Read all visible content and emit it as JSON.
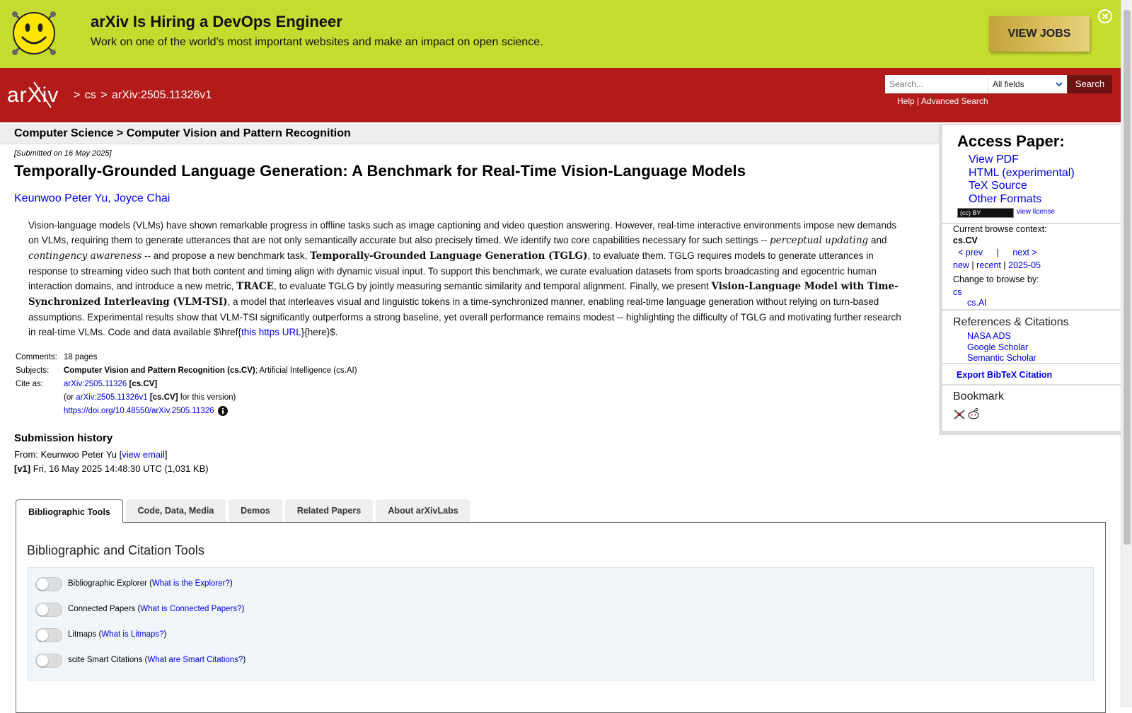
{
  "banner": {
    "title": "arXiv Is Hiring a DevOps Engineer",
    "subtitle": "Work on one of the world's most important websites and make an impact on open science.",
    "cta": "VIEW JOBS"
  },
  "header": {
    "logo_text": "arXiv",
    "breadcrumb": [
      ">",
      "cs",
      ">",
      "arXiv:2505.11326v1"
    ],
    "search_placeholder": "Search...",
    "search_field": "All fields",
    "search_button": "Search",
    "help": "Help",
    "sep": "|",
    "advanced": "Advanced Search"
  },
  "subheader": "Computer Science > Computer Vision and Pattern Recognition",
  "paper": {
    "submitted": "[Submitted on 16 May 2025]",
    "title": "Temporally-Grounded Language Generation: A Benchmark for Real-Time Vision-Language Models",
    "authors": [
      "Keunwoo Peter Yu",
      "Joyce Chai"
    ],
    "author_sep": ", ",
    "abstract": {
      "p1": "Vision-language models (VLMs) have shown remarkable progress in offline tasks such as image captioning and video question answering. However, real-time interactive environments impose new demands on VLMs, requiring them to generate utterances that are not only semantically accurate but also precisely timed. We identify two core capabilities necessary for such settings -- ",
      "m1": "perceptual updating",
      "p2": " and ",
      "m2": "contingency awareness",
      "p3": " -- and propose a new benchmark task, ",
      "m3": "Temporally-Grounded Language Generation (TGLG)",
      "p4": ", to evaluate them. TGLG requires models to generate utterances in response to streaming video such that both content and timing align with dynamic visual input. To support this benchmark, we curate evaluation datasets from sports broadcasting and egocentric human interaction domains, and introduce a new metric, ",
      "m4": "TRACE",
      "p5": ", to evaluate TGLG by jointly measuring semantic similarity and temporal alignment. Finally, we present ",
      "m5": "Vision-Language Model with Time-Synchronized Interleaving (VLM-TSI)",
      "p6": ", a model that interleaves visual and linguistic tokens in a time-synchronized manner, enabling real-time language generation without relying on turn-based assumptions. Experimental results show that VLM-TSI significantly outperforms a strong baseline, yet overall performance remains modest -- highlighting the difficulty of TGLG and motivating further research in real-time VLMs. Code and data available $\\href{",
      "link": "this https URL",
      "p7": "}{here}$."
    },
    "meta": {
      "comments_label": "Comments:",
      "comments": "18 pages",
      "subjects_label": "Subjects:",
      "subjects_primary": "Computer Vision and Pattern Recognition (cs.CV)",
      "subjects_rest": "; Artificial Intelligence (cs.AI)",
      "cite_label": "Cite as:",
      "cite_id": "arXiv:2505.11326",
      "cite_cat": " [cs.CV]",
      "cite_or": "(or ",
      "cite_version": "arXiv:2505.11326v1",
      "cite_version_cat": " [cs.CV]",
      "cite_version_tail": " for this version)",
      "doi": "https://doi.org/10.48550/arXiv.2505.11326"
    },
    "history": {
      "title": "Submission history",
      "from_prefix": "From: Keunwoo Peter Yu [",
      "view_email": "view email",
      "from_suffix": "]",
      "v1_tag": "[v1]",
      "v1_text": " Fri, 16 May 2025 14:48:30 UTC (1,031 KB)"
    }
  },
  "tabs": [
    "Bibliographic Tools",
    "Code, Data, Media",
    "Demos",
    "Related Papers",
    "About arXivLabs"
  ],
  "tools_panel": {
    "title": "Bibliographic and Citation Tools",
    "rows": [
      {
        "label": "Bibliographic Explorer",
        "help": "What is the Explorer?"
      },
      {
        "label": "Connected Papers",
        "help": "What is Connected Papers?"
      },
      {
        "label": "Litmaps",
        "help": "What is Litmaps?"
      },
      {
        "label": "scite Smart Citations",
        "help": "What are Smart Citations?"
      }
    ]
  },
  "sidebar": {
    "access_title": "Access Paper:",
    "access_links": [
      "View PDF",
      "HTML (experimental)",
      "TeX Source",
      "Other Formats"
    ],
    "license_badge": "(cc) BY",
    "view_license": "view license",
    "browse_context_label": "Current browse context:",
    "browse_context": "cs.CV",
    "prev": "< prev",
    "pipe": "|",
    "next": "next >",
    "new": "new",
    "recent": "recent",
    "month": "2025-05",
    "change_browse": "Change to browse by:",
    "cat1": "cs",
    "cat2": "cs.AI",
    "refs_title": "References & Citations",
    "refs": [
      "NASA ADS",
      "Google Scholar",
      "Semantic Scholar"
    ],
    "bibtex": "Export BibTeX Citation",
    "bookmark": "Bookmark"
  },
  "colors": {
    "banner": "#c5db2f",
    "header": "#b31b1b",
    "link": "#0000ee"
  }
}
